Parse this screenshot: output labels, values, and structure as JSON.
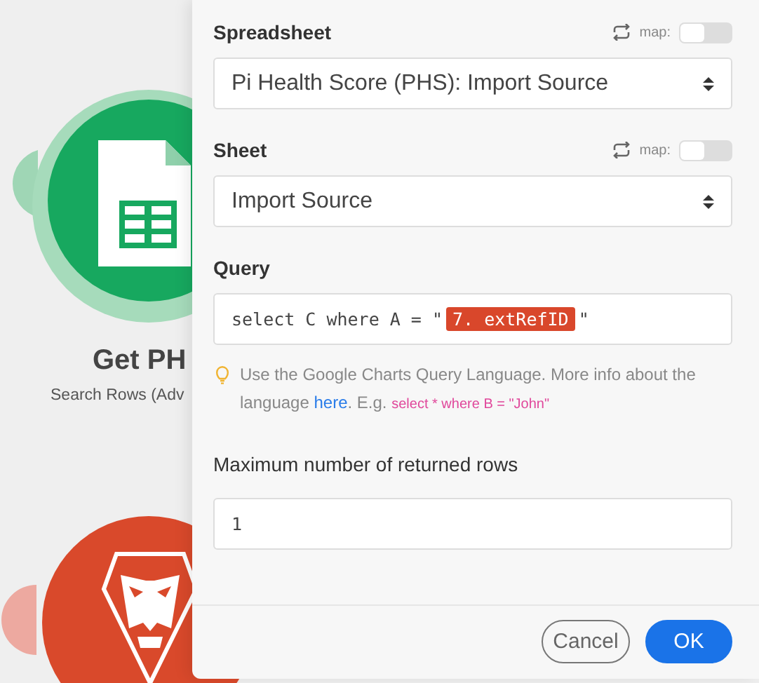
{
  "canvas": {
    "modules": [
      {
        "kind": "sheets",
        "title": "Get PH",
        "subtitle": "Search Rows (Adv"
      },
      {
        "kind": "shield"
      }
    ]
  },
  "panel": {
    "fields": [
      {
        "kind": "select",
        "label": "Spreadsheet",
        "bold": true,
        "map_label": "map:",
        "map_on": false,
        "value": "Pi Health Score (PHS): Import Source"
      },
      {
        "kind": "select",
        "label": "Sheet",
        "bold": true,
        "map_label": "map:",
        "map_on": false,
        "value": "Import Source"
      },
      {
        "kind": "query",
        "label": "Query",
        "bold": true,
        "value_before": "select C where A = \"",
        "token": "7. extRefID",
        "value_after": "\"",
        "hint": "Use the Google Charts Query Language. More info about the language ",
        "hint_link": "here",
        "hint_after": ". E.g. ",
        "hint_example": "select * where B = \"John\""
      },
      {
        "kind": "text",
        "label": "Maximum number of returned rows",
        "bold": false,
        "value": "1"
      }
    ],
    "buttons": [
      {
        "label": "Cancel",
        "kind": "secondary"
      },
      {
        "label": "OK",
        "kind": "primary"
      }
    ]
  }
}
